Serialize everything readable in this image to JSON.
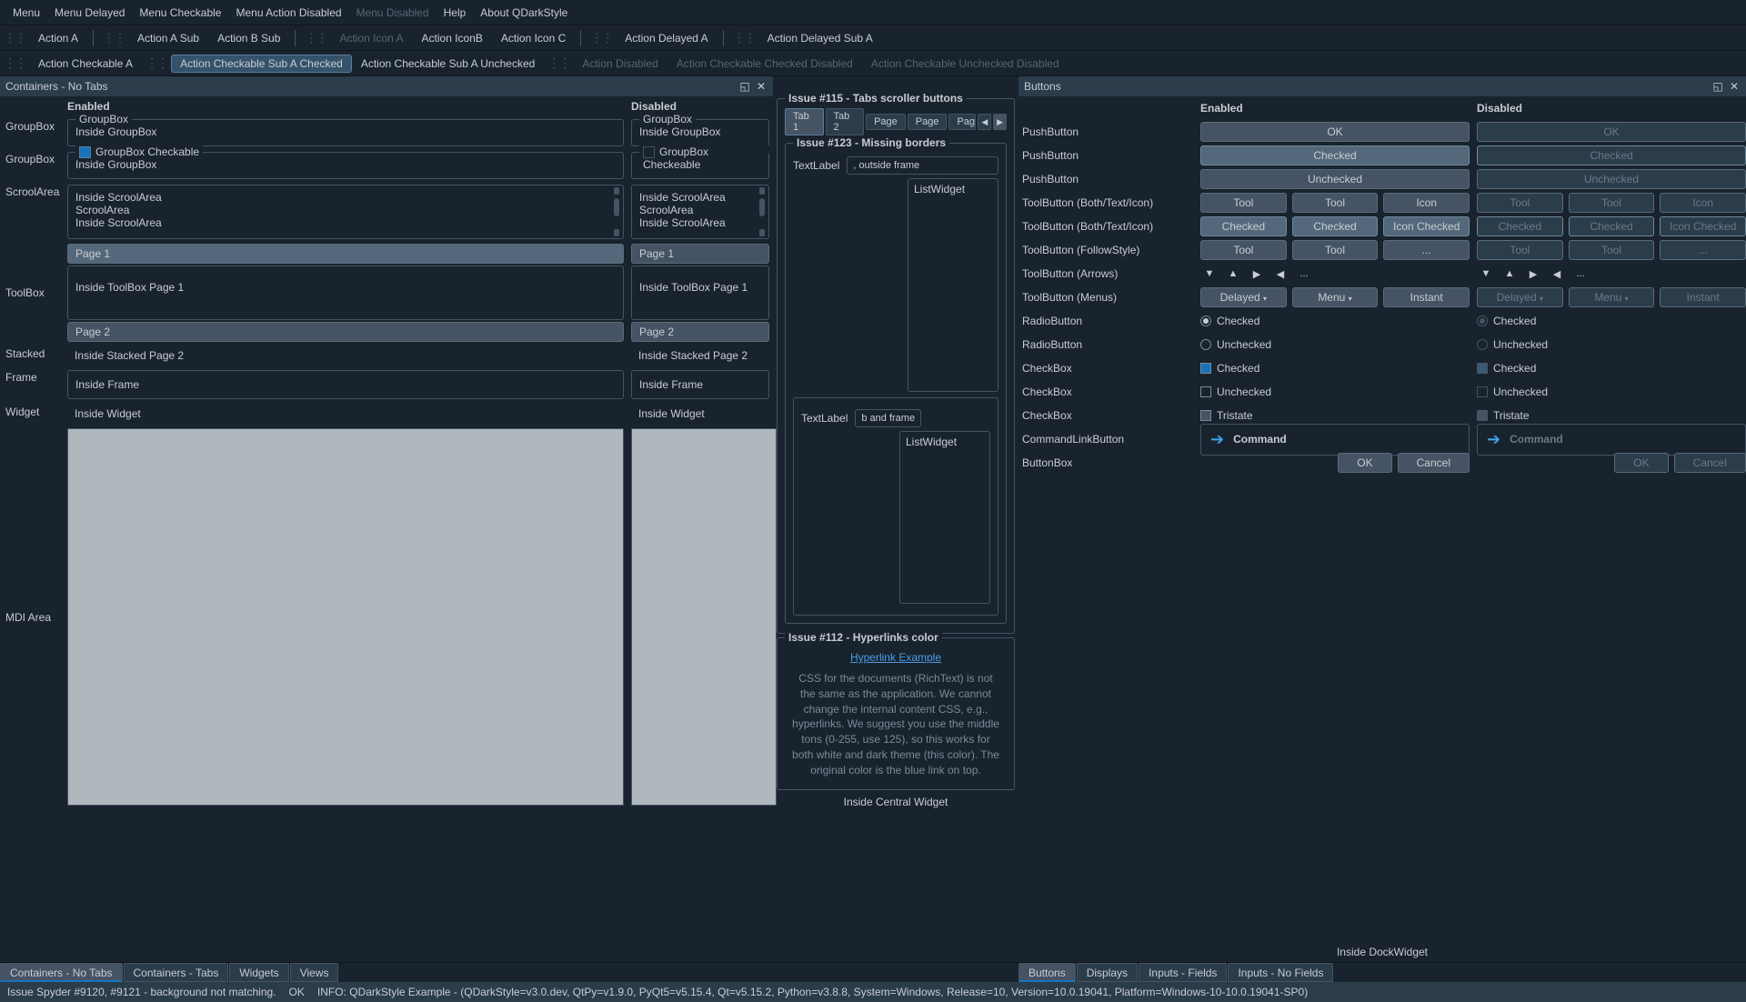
{
  "menubar": [
    "Menu",
    "Menu Delayed",
    "Menu Checkable",
    "Menu Action Disabled",
    "Menu Disabled",
    "Help",
    "About QDarkStyle"
  ],
  "menubar_disabled_idx": 4,
  "toolbar1": {
    "groups": [
      [
        "Action A"
      ],
      [
        "Action A Sub",
        "Action B Sub"
      ],
      [
        "Action Icon A",
        "Action IconB",
        "Action Icon C"
      ],
      [
        "Action Delayed A"
      ],
      [
        "Action Delayed Sub A"
      ]
    ],
    "disabled": [
      "Action Icon A"
    ]
  },
  "toolbar2": {
    "items": [
      "Action Checkable A",
      "Action Checkable Sub A Checked",
      "Action Checkable Sub A Unchecked",
      "Action Disabled",
      "Action Checkable Checked Disabled",
      "Action Checkable Unchecked Disabled"
    ],
    "checked": [
      "Action Checkable Sub A Checked"
    ],
    "disabled": [
      "Action Disabled",
      "Action Checkable Checked Disabled",
      "Action Checkable Unchecked Disabled"
    ]
  },
  "dock_left_title": "Containers - No Tabs",
  "dock_right_title": "Buttons",
  "columns": {
    "enabled": "Enabled",
    "disabled": "Disabled"
  },
  "rows": {
    "groupbox": "GroupBox",
    "groupbox2": "GroupBox",
    "scrool": "ScroolArea",
    "toolbox": "ToolBox",
    "stacked": "Stacked",
    "frame": "Frame",
    "widget": "Widget",
    "mdi": "MDI Area"
  },
  "groupbox": {
    "title": "GroupBox",
    "inside": "Inside GroupBox",
    "checkable_title": "GroupBox Checkable",
    "checkable_title_dis": "GroupBox Checkeable"
  },
  "scroll_lines": [
    "Inside ScroolArea",
    "ScroolArea",
    "Inside ScroolArea"
  ],
  "toolbox": {
    "page1": "Page 1",
    "page2": "Page 2",
    "inside": "Inside ToolBox Page 1"
  },
  "stacked": {
    "en": "Inside Stacked Page 2",
    "dis": "Inside Stacked Page 2"
  },
  "frame": {
    "en": "Inside Frame",
    "dis": "Inside Frame"
  },
  "widget": {
    "en": "Inside Widget",
    "dis": "Inside Widget"
  },
  "center": {
    "issue115": "Issue #115 - Tabs scroller buttons",
    "tabs": [
      "Tab 1",
      "Tab 2",
      "Page",
      "Page",
      "Page"
    ],
    "issue123": "Issue #123 - Missing borders",
    "textlabel": "TextLabel",
    "field1": ", outside frame",
    "listwidget": "ListWidget",
    "field2": "b and frame",
    "issue112": "Issue #112 - Hyperlinks color",
    "hyperlink": "Hyperlink Example",
    "desc": "CSS for the documents (RichText) is not the same as the application. We cannot change the internal content CSS, e.g., hyperlinks. We suggest you use the middle tons (0-255, use 125), so this works for both white and dark theme (this color). The original color is the blue link on top.",
    "central": "Inside Central Widget",
    "dock": "Inside DockWidget"
  },
  "buttons": {
    "rows": [
      {
        "label": "PushButton",
        "type": "btn",
        "en": [
          "OK"
        ],
        "dis": [
          "OK"
        ]
      },
      {
        "label": "PushButton",
        "type": "btn-checked",
        "en": [
          "Checked"
        ],
        "dis": [
          "Checked"
        ]
      },
      {
        "label": "PushButton",
        "type": "btn",
        "en": [
          "Unchecked"
        ],
        "dis": [
          "Unchecked"
        ]
      },
      {
        "label": "ToolButton (Both/Text/Icon)",
        "type": "btn3",
        "en": [
          "Tool",
          "Tool",
          "Icon"
        ],
        "dis": [
          "Tool",
          "Tool",
          "Icon"
        ]
      },
      {
        "label": "ToolButton (Both/Text/Icon)",
        "type": "btn3-checked",
        "en": [
          "Checked",
          "Checked",
          "Icon Checked"
        ],
        "dis": [
          "Checked",
          "Checked",
          "Icon Checked"
        ]
      },
      {
        "label": "ToolButton (FollowStyle)",
        "type": "btn2",
        "en": [
          "Tool",
          "Tool",
          "..."
        ],
        "dis": [
          "Tool",
          "Tool",
          "..."
        ]
      },
      {
        "label": "ToolButton (Arrows)",
        "type": "arrows"
      },
      {
        "label": "ToolButton (Menus)",
        "type": "menus",
        "en": [
          "Delayed",
          "Menu",
          "Instant"
        ],
        "dis": [
          "Delayed",
          "Menu",
          "Instant"
        ]
      },
      {
        "label": "RadioButton",
        "type": "radio-on",
        "text": "Checked"
      },
      {
        "label": "RadioButton",
        "type": "radio-off",
        "text": "Unchecked"
      },
      {
        "label": "CheckBox",
        "type": "check-on",
        "text": "Checked"
      },
      {
        "label": "CheckBox",
        "type": "check-off",
        "text": "Unchecked"
      },
      {
        "label": "CheckBox",
        "type": "check-tri",
        "text": "Tristate"
      },
      {
        "label": "CommandLinkButton",
        "type": "cmd",
        "text": "Command"
      },
      {
        "label": "ButtonBox",
        "type": "bbox",
        "en": [
          "OK",
          "Cancel"
        ],
        "dis": [
          "OK",
          "Cancel"
        ]
      }
    ]
  },
  "bottom_tabs_left": [
    "Containers - No Tabs",
    "Containers - Tabs",
    "Widgets",
    "Views"
  ],
  "bottom_tabs_right": [
    "Buttons",
    "Displays",
    "Inputs - Fields",
    "Inputs - No Fields"
  ],
  "status": {
    "left": "Issue Spyder #9120, #9121 - background not matching.",
    "ok": "OK",
    "info": "INFO: QDarkStyle Example - (QDarkStyle=v3.0.dev, QtPy=v1.9.0, PyQt5=v5.15.4, Qt=v5.15.2, Python=v3.8.8, System=Windows, Release=10, Version=10.0.19041, Platform=Windows-10-10.0.19041-SP0)"
  }
}
